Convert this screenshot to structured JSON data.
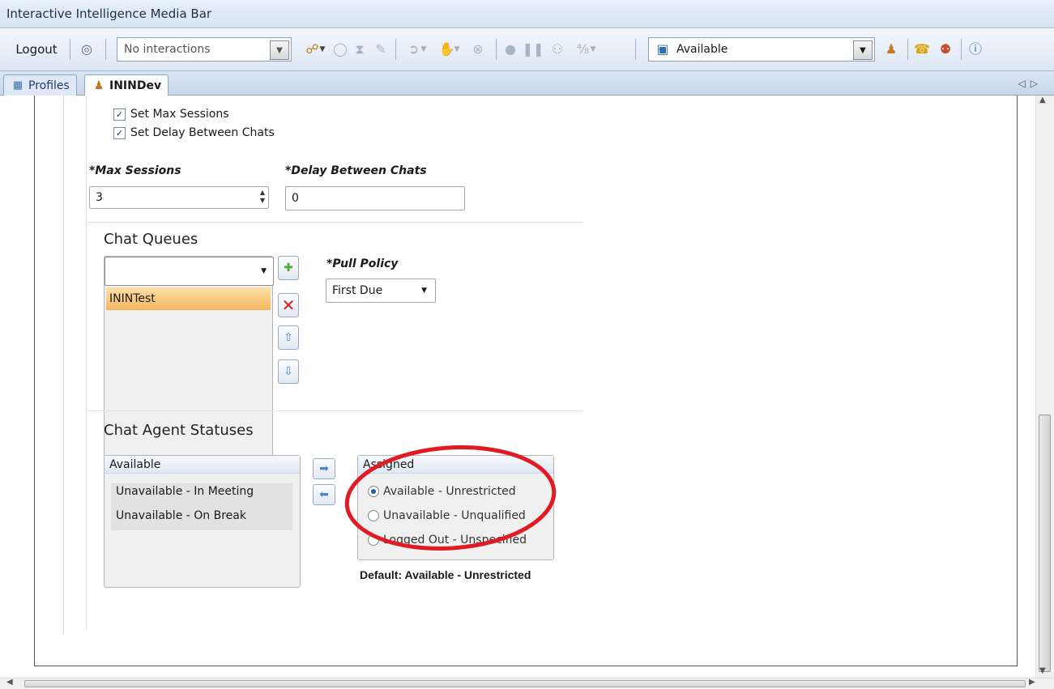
{
  "window": {
    "title": "Interactive Intelligence Media Bar"
  },
  "toolbar": {
    "logout_label": "Logout",
    "interactions_value": "No interactions",
    "status_value": "Available"
  },
  "tabs": [
    {
      "label": "Profiles",
      "icon": "grid-icon"
    },
    {
      "label": "ININDev",
      "icon": "user-icon"
    }
  ],
  "form": {
    "checkbox_max_sessions": "Set Max Sessions",
    "checkbox_delay": "Set Delay Between Chats",
    "max_sessions_label": "*Max Sessions",
    "max_sessions_value": "3",
    "delay_label": "*Delay Between Chats",
    "delay_value": "0"
  },
  "chat_queues": {
    "title": "Chat Queues",
    "combo_value": "",
    "items": [
      "ININTest"
    ],
    "pull_policy_label": "*Pull Policy",
    "pull_policy_value": "First Due"
  },
  "agent_statuses": {
    "title": "Chat Agent Statuses",
    "available_header": "Available",
    "available_items": [
      "Unavailable - In Meeting",
      "Unavailable - On Break"
    ],
    "assigned_header": "Assigned",
    "assigned_items": [
      {
        "label": "Available - Unrestricted",
        "selected": true
      },
      {
        "label": "Unavailable - Unqualified",
        "selected": false
      },
      {
        "label": "Logged Out - Unspecified",
        "selected": false
      }
    ],
    "default_label": "Default:",
    "default_value": "Available - Unrestricted"
  },
  "colors": {
    "annotation_circle": "#e01b24",
    "selected_row": "#f7b85a"
  }
}
